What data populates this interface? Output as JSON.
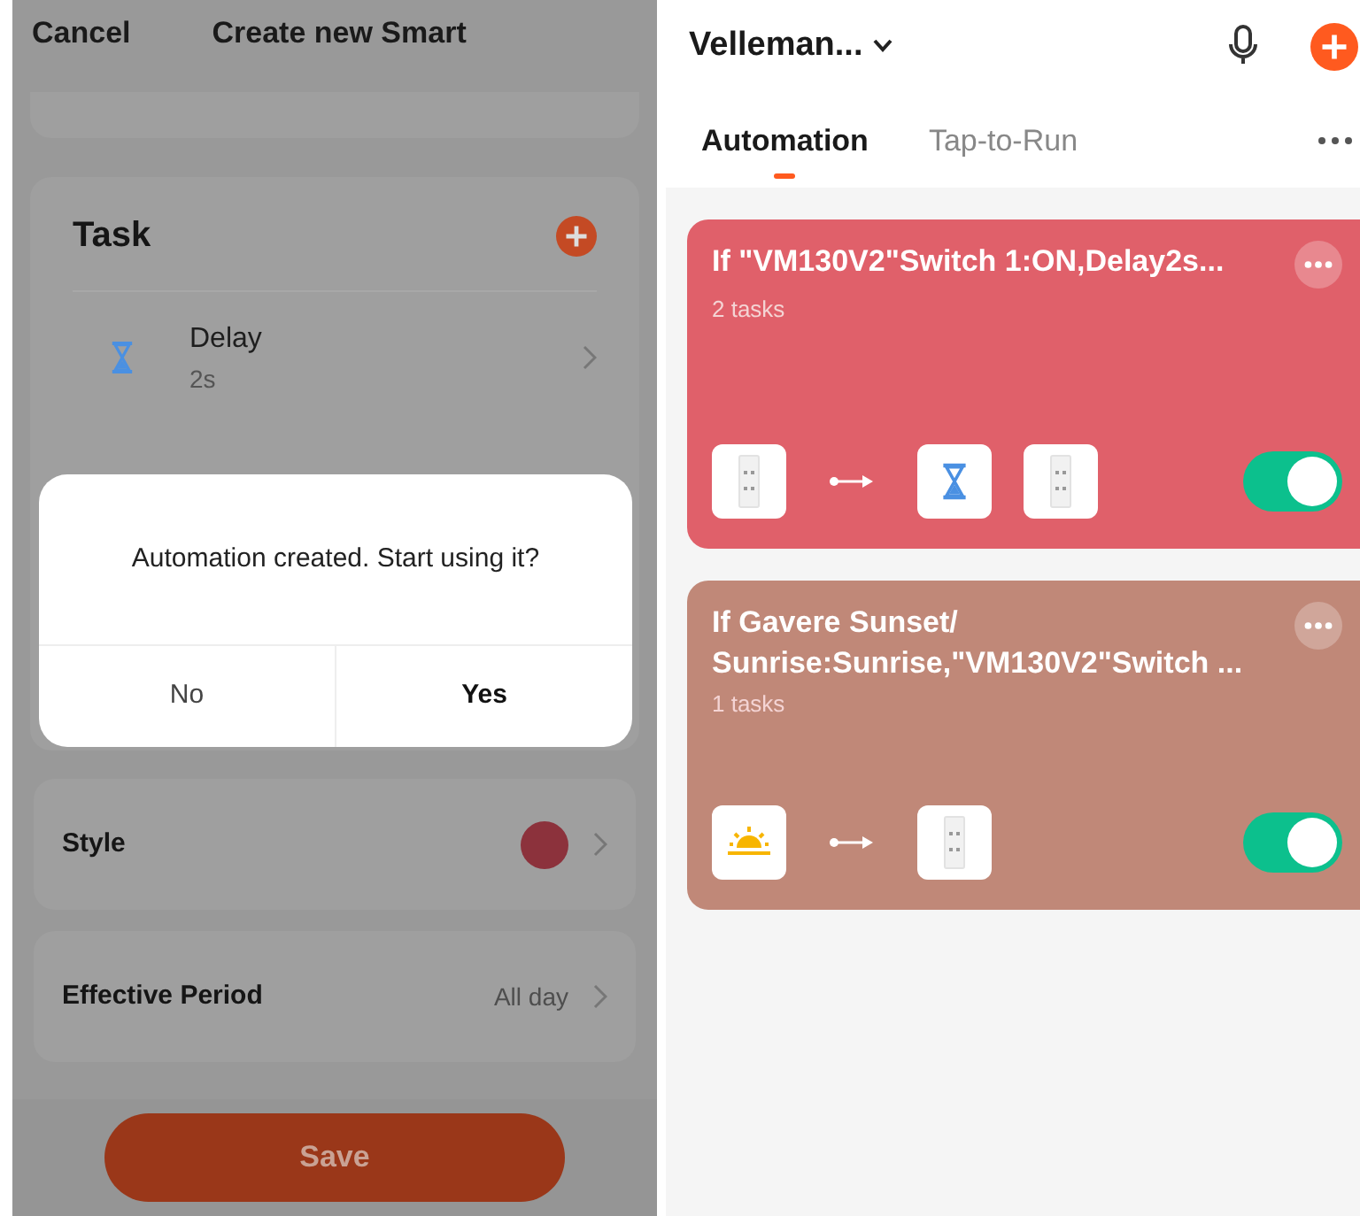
{
  "editor": {
    "cancel": "Cancel",
    "title": "Create new Smart",
    "task_section": {
      "title": "Task",
      "items": [
        {
          "kind": "delay",
          "title": "Delay",
          "subtitle": "2s"
        }
      ]
    },
    "dialog": {
      "message": "Automation created. Start using it?",
      "buttons": [
        {
          "label": "No",
          "primary": false
        },
        {
          "label": "Yes",
          "primary": true
        }
      ]
    },
    "style": {
      "label": "Style",
      "color": "#8c323c"
    },
    "effective_period": {
      "label": "Effective Period",
      "value": "All day"
    },
    "save": "Save"
  },
  "scenes_screen": {
    "home": "Velleman...",
    "tabs": [
      {
        "label": "Automation",
        "selected": true
      },
      {
        "label": "Tap-to-Run",
        "selected": false
      }
    ],
    "automations": [
      {
        "title": "If \"VM130V2\"Switch 1:ON,Delay2s...",
        "tasks": "2 tasks",
        "color": "#e0606a",
        "on": true,
        "conditions": [
          {
            "kind": "device"
          }
        ],
        "actions": [
          {
            "kind": "delay"
          },
          {
            "kind": "device"
          }
        ]
      },
      {
        "title": "If Gavere Sunset/ Sunrise:Sunrise,\"VM130V2\"Switch ...",
        "tasks": "1 tasks",
        "color": "#c08878",
        "on": true,
        "conditions": [
          {
            "kind": "sunrise"
          }
        ],
        "actions": [
          {
            "kind": "device"
          }
        ]
      }
    ]
  }
}
